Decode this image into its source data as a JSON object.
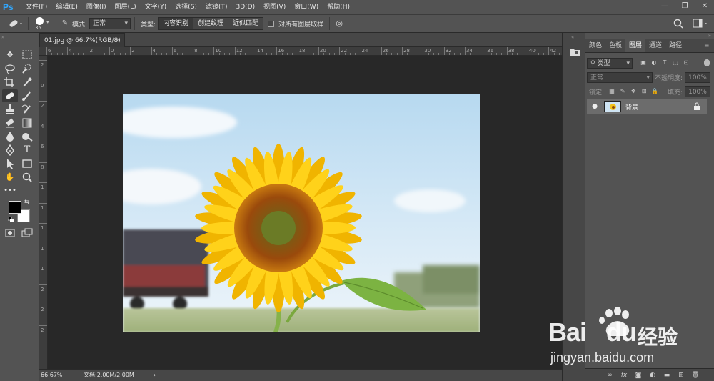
{
  "app": {
    "logo": "Ps"
  },
  "menus": [
    "文件(F)",
    "编辑(E)",
    "图像(I)",
    "图层(L)",
    "文字(Y)",
    "选择(S)",
    "滤镜(T)",
    "3D(D)",
    "视图(V)",
    "窗口(W)",
    "帮助(H)"
  ],
  "window_buttons": {
    "minimize": "—",
    "restore": "❐",
    "close": "✕"
  },
  "options": {
    "brush_size": "35",
    "mode_label": "模式:",
    "mode_value": "正常",
    "type_label": "类型:",
    "type_options": [
      "内容识别",
      "创建纹理",
      "近似匹配"
    ],
    "sample_all_label": "对所有图层取样"
  },
  "document": {
    "tab_title": "01.jpg @ 66.7%(RGB/8)",
    "close_glyph": "×",
    "zoom": "66.67%",
    "doc_info": "文档:2.00M/2.00M",
    "arrow": "›"
  },
  "ruler": {
    "h_labels": [
      "6",
      "4",
      "2",
      "0",
      "2",
      "4",
      "6",
      "8",
      "10",
      "12",
      "14",
      "16",
      "18",
      "20",
      "22",
      "24",
      "26",
      "28",
      "30",
      "32",
      "34",
      "36",
      "38",
      "40",
      "42"
    ],
    "v_labels": [
      "2",
      "0",
      "2",
      "4",
      "6",
      "8",
      "1",
      "1",
      "1",
      "1",
      "1",
      "2",
      "2",
      "2"
    ]
  },
  "panels": {
    "tabs": [
      "颜色",
      "色板",
      "图层",
      "通道",
      "路径"
    ],
    "active_tab": "图层",
    "filter_label": "类型",
    "blend_mode": "正常",
    "opacity_label": "不透明度:",
    "opacity_value": "100%",
    "lock_label": "锁定:",
    "fill_label": "填充:",
    "fill_value": "100%",
    "layer_name": "背景"
  },
  "watermark": {
    "brand": "Bai",
    "brand2": "du",
    "cn": "经验",
    "url": "jingyan.baidu.com"
  },
  "colors": {
    "accent": "#31a8ff",
    "bg": "#535353",
    "canvas": "#282828"
  }
}
